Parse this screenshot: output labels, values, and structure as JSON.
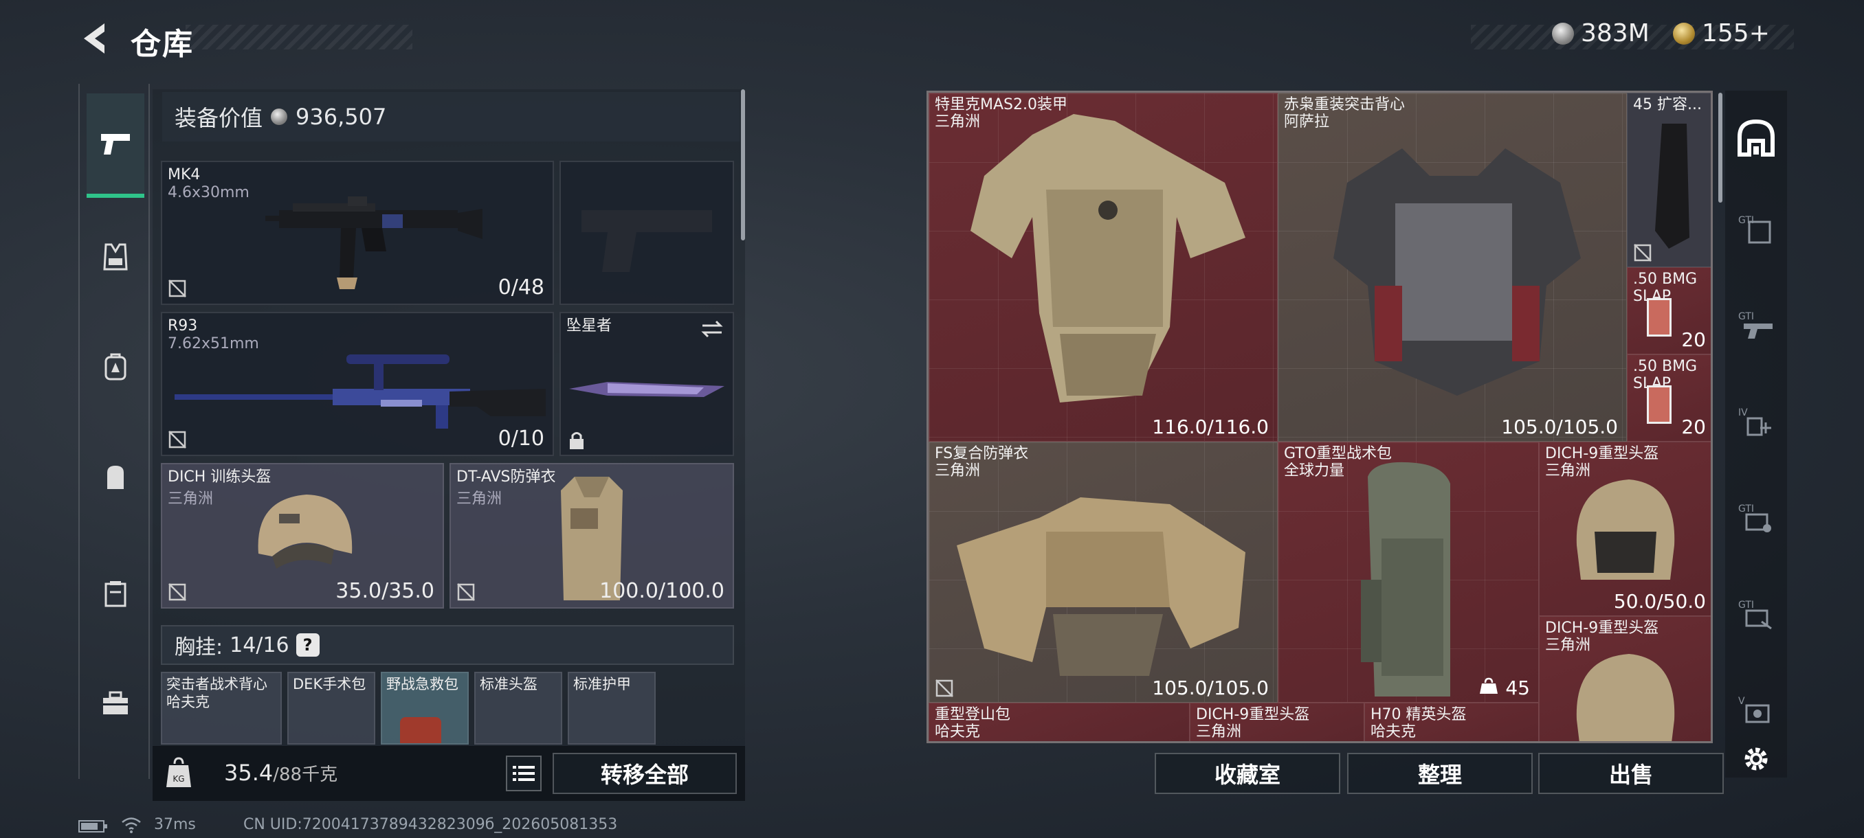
{
  "header": {
    "title": "仓库",
    "currency_silver": "383M",
    "currency_gold": "155+"
  },
  "equipment": {
    "value_label": "装备价值",
    "value": "936,507"
  },
  "weapons": [
    {
      "name": "MK4",
      "caliber": "4.6x30mm",
      "ammo": "0/48"
    },
    {
      "name": "R93",
      "caliber": "7.62x51mm",
      "ammo": "0/10"
    }
  ],
  "melee": {
    "name": "坠星者"
  },
  "gear": [
    {
      "name": "DICH 训练头盔",
      "brand": "三角洲",
      "durability": "35.0/35.0"
    },
    {
      "name": "DT-AVS防弹衣",
      "brand": "三角洲",
      "durability": "100.0/100.0"
    }
  ],
  "chest_rig": {
    "label": "胸挂:",
    "capacity": "14/16",
    "help": "?"
  },
  "chest_items": [
    {
      "name": "突击者战术背心",
      "brand": "哈夫克"
    },
    {
      "name": "DEK手术包"
    },
    {
      "name": "野战急救包"
    },
    {
      "name": "标准头盔"
    },
    {
      "name": "标准护甲"
    }
  ],
  "bottom": {
    "weight": "35.4",
    "weight_max": "/88千克",
    "transfer_all": "转移全部"
  },
  "stash": {
    "items": [
      {
        "name": "特里克MAS2.0装甲",
        "brand": "三角洲",
        "value": "116.0/116.0"
      },
      {
        "name": "赤枭重装突击背心",
        "brand": "阿萨拉",
        "value": "105.0/105.0"
      },
      {
        "name": "45 扩容...",
        "brand": ""
      },
      {
        "name": ".50 BMG",
        "brand": "SLAP",
        "value": "20"
      },
      {
        "name": ".50 BMG",
        "brand": "SLAP",
        "value": "20"
      },
      {
        "name": "FS复合防弹衣",
        "brand": "三角洲",
        "value": "105.0/105.0"
      },
      {
        "name": "GTO重型战术包",
        "brand": "全球力量",
        "value": "45"
      },
      {
        "name": "DICH-9重型头盔",
        "brand": "三角洲",
        "value": "50.0/50.0"
      },
      {
        "name": "DICH-9重型头盔",
        "brand": "三角洲"
      },
      {
        "name": "重型登山包",
        "brand": "哈夫克"
      },
      {
        "name": "DICH-9重型头盔",
        "brand": "三角洲"
      },
      {
        "name": "H70 精英头盔",
        "brand": "哈夫克"
      }
    ],
    "buttons": {
      "collection": "收藏室",
      "sort": "整理",
      "sell": "出售"
    }
  },
  "status": {
    "ping": "37ms",
    "uid": "CN UID:7200417378943282309б_202605081353"
  },
  "colors": {
    "accent": "#2fc48a",
    "red_cell": "#6a2d33"
  }
}
